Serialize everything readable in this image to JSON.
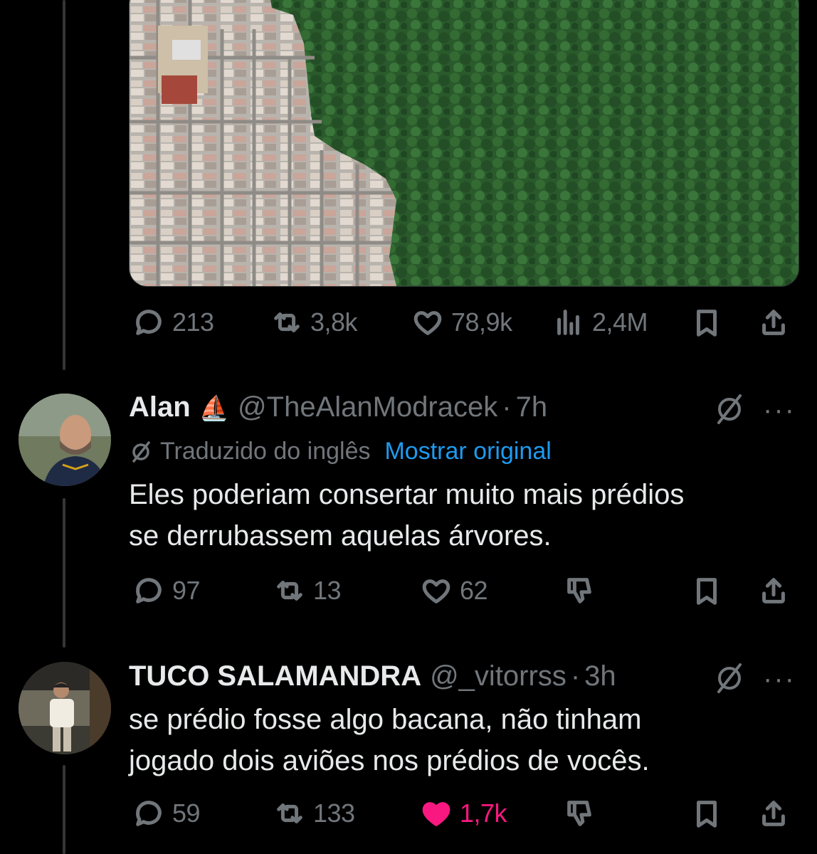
{
  "main_post": {
    "stats": {
      "replies": "213",
      "reposts": "3,8k",
      "likes": "78,9k",
      "views": "2,4M"
    }
  },
  "replies": [
    {
      "name": "Alan",
      "badge_emoji": "⛵",
      "handle": "@TheAlanModracek",
      "separator": "·",
      "time": "7h",
      "translated_label": "Traduzido do inglês",
      "show_original": "Mostrar original",
      "text": "Eles poderiam consertar muito mais prédios\nse derrubassem aquelas árvores.",
      "stats": {
        "replies": "97",
        "reposts": "13",
        "likes": "62"
      }
    },
    {
      "name": "TUCO SALAMANDRA",
      "handle": "@_vitorrss",
      "separator": "·",
      "time": "3h",
      "text": "se prédio fosse algo bacana, não tinham\njogado dois aviões nos prédios de vocês.",
      "stats": {
        "replies": "59",
        "reposts": "133",
        "likes": "1,7k"
      },
      "liked": true
    }
  ],
  "icons": {
    "reply": "reply-bubble-icon",
    "repost": "repost-icon",
    "like": "heart-icon",
    "views": "views-chart-icon",
    "bookmark": "bookmark-icon",
    "share": "share-icon",
    "dislike": "thumbs-down-icon",
    "grok": "grok-slash-icon",
    "more": "more-dots-icon"
  },
  "colors": {
    "background": "#000000",
    "text": "#e7e9ea",
    "muted": "#71767b",
    "link": "#1d9bf0",
    "like_active": "#f91880"
  }
}
